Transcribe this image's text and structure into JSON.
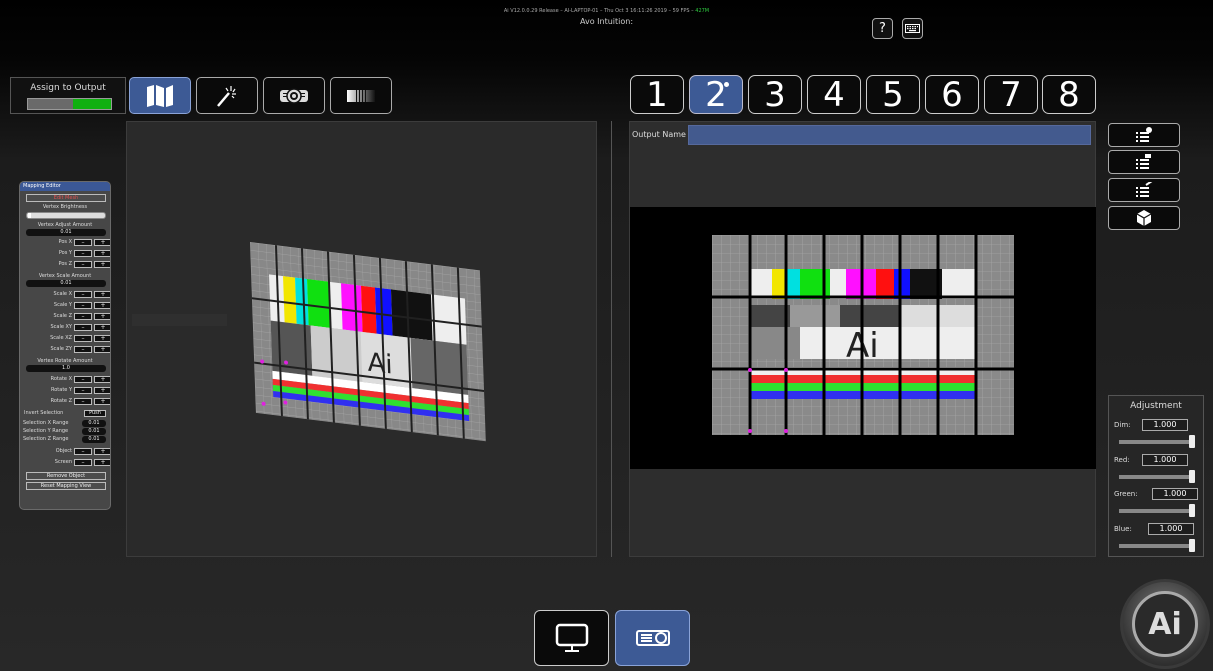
{
  "status_bar": {
    "text": "Ai V12.0.0.29 Release – AI-LAPTOP-01 – Thu Oct  3 16:11:26 2019 – 59 FPS – ",
    "fps": "427M"
  },
  "app_title": "Avo Intuition:",
  "top_icons": {
    "help": "?",
    "help_icon": "question-mark-icon",
    "keyboard_icon": "keyboard-icon"
  },
  "assign_output": {
    "label": "Assign to Output",
    "state": "on"
  },
  "tool_tabs": [
    {
      "name": "mapping",
      "icon": "map-icon",
      "active": true
    },
    {
      "name": "effects",
      "icon": "magic-wand-icon",
      "active": false
    },
    {
      "name": "projector",
      "icon": "projector-icon",
      "active": false
    },
    {
      "name": "blend",
      "icon": "gradient-icon",
      "active": false
    }
  ],
  "outputs": {
    "tabs": [
      "1",
      "2",
      "3",
      "4",
      "5",
      "6",
      "7",
      "8"
    ],
    "selected": "2"
  },
  "output_name": {
    "label": "Output Name",
    "value": ""
  },
  "side_buttons": [
    {
      "icon": "list-gear-icon"
    },
    {
      "icon": "list-layers-icon"
    },
    {
      "icon": "list-check-icon"
    },
    {
      "icon": "cube-icon"
    }
  ],
  "adjustment": {
    "title": "Adjustment",
    "rows": [
      {
        "label": "Dim:",
        "value": "1.000",
        "level": 1.0
      },
      {
        "label": "Red:",
        "value": "1.000",
        "level": 1.0
      },
      {
        "label": "Green:",
        "value": "1.000",
        "level": 1.0
      },
      {
        "label": "Blue:",
        "value": "1.000",
        "level": 1.0
      }
    ]
  },
  "mapping_editor": {
    "title": "Mapping Editor",
    "edit_mesh": "Edit Mesh",
    "vertex_brightness": "Vertex Brightness",
    "vertex_adjust_amount": "Vertex Adjust Amount",
    "vertex_adjust_value": "0.01",
    "pos_x": "Pos X",
    "pos_y": "Pos Y",
    "pos_z": "Pos Z",
    "vertex_scale_amount": "Vertex Scale Amount",
    "vertex_scale_value": "0.01",
    "scale_x": "Scale X",
    "scale_y": "Scale Y",
    "scale_z": "Scale Z",
    "scale_xy": "Scale XY",
    "scale_xz": "Scale XZ",
    "scale_zy": "Scale ZY",
    "vertex_rotate_amount": "Vertex Rotate Amount",
    "vertex_rotate_value": "1.0",
    "rotate_x": "Rotate X",
    "rotate_y": "Rotate Y",
    "rotate_z": "Rotate Z",
    "invert_selection": "Invert Selection",
    "push": "Push",
    "selection_x_range": "Selection X Range",
    "selection_y_range": "Selection Y Range",
    "selection_z_range": "Selection Z Range",
    "range_value": "0.01",
    "object": "Object",
    "screen": "Screen",
    "remove_object": "Remove Object",
    "reset_mapping_view": "Reset Mapping View",
    "minus": "–",
    "plus": "+"
  },
  "bottom_buttons": [
    {
      "name": "display",
      "icon": "monitor-icon",
      "active": false
    },
    {
      "name": "projector",
      "icon": "projector-icon",
      "active": true
    }
  ],
  "logo": {
    "text": "Ai"
  },
  "colors": {
    "accent": "#3d5a95",
    "toggle_on": "#10b010",
    "vertex": "#e020e0"
  }
}
